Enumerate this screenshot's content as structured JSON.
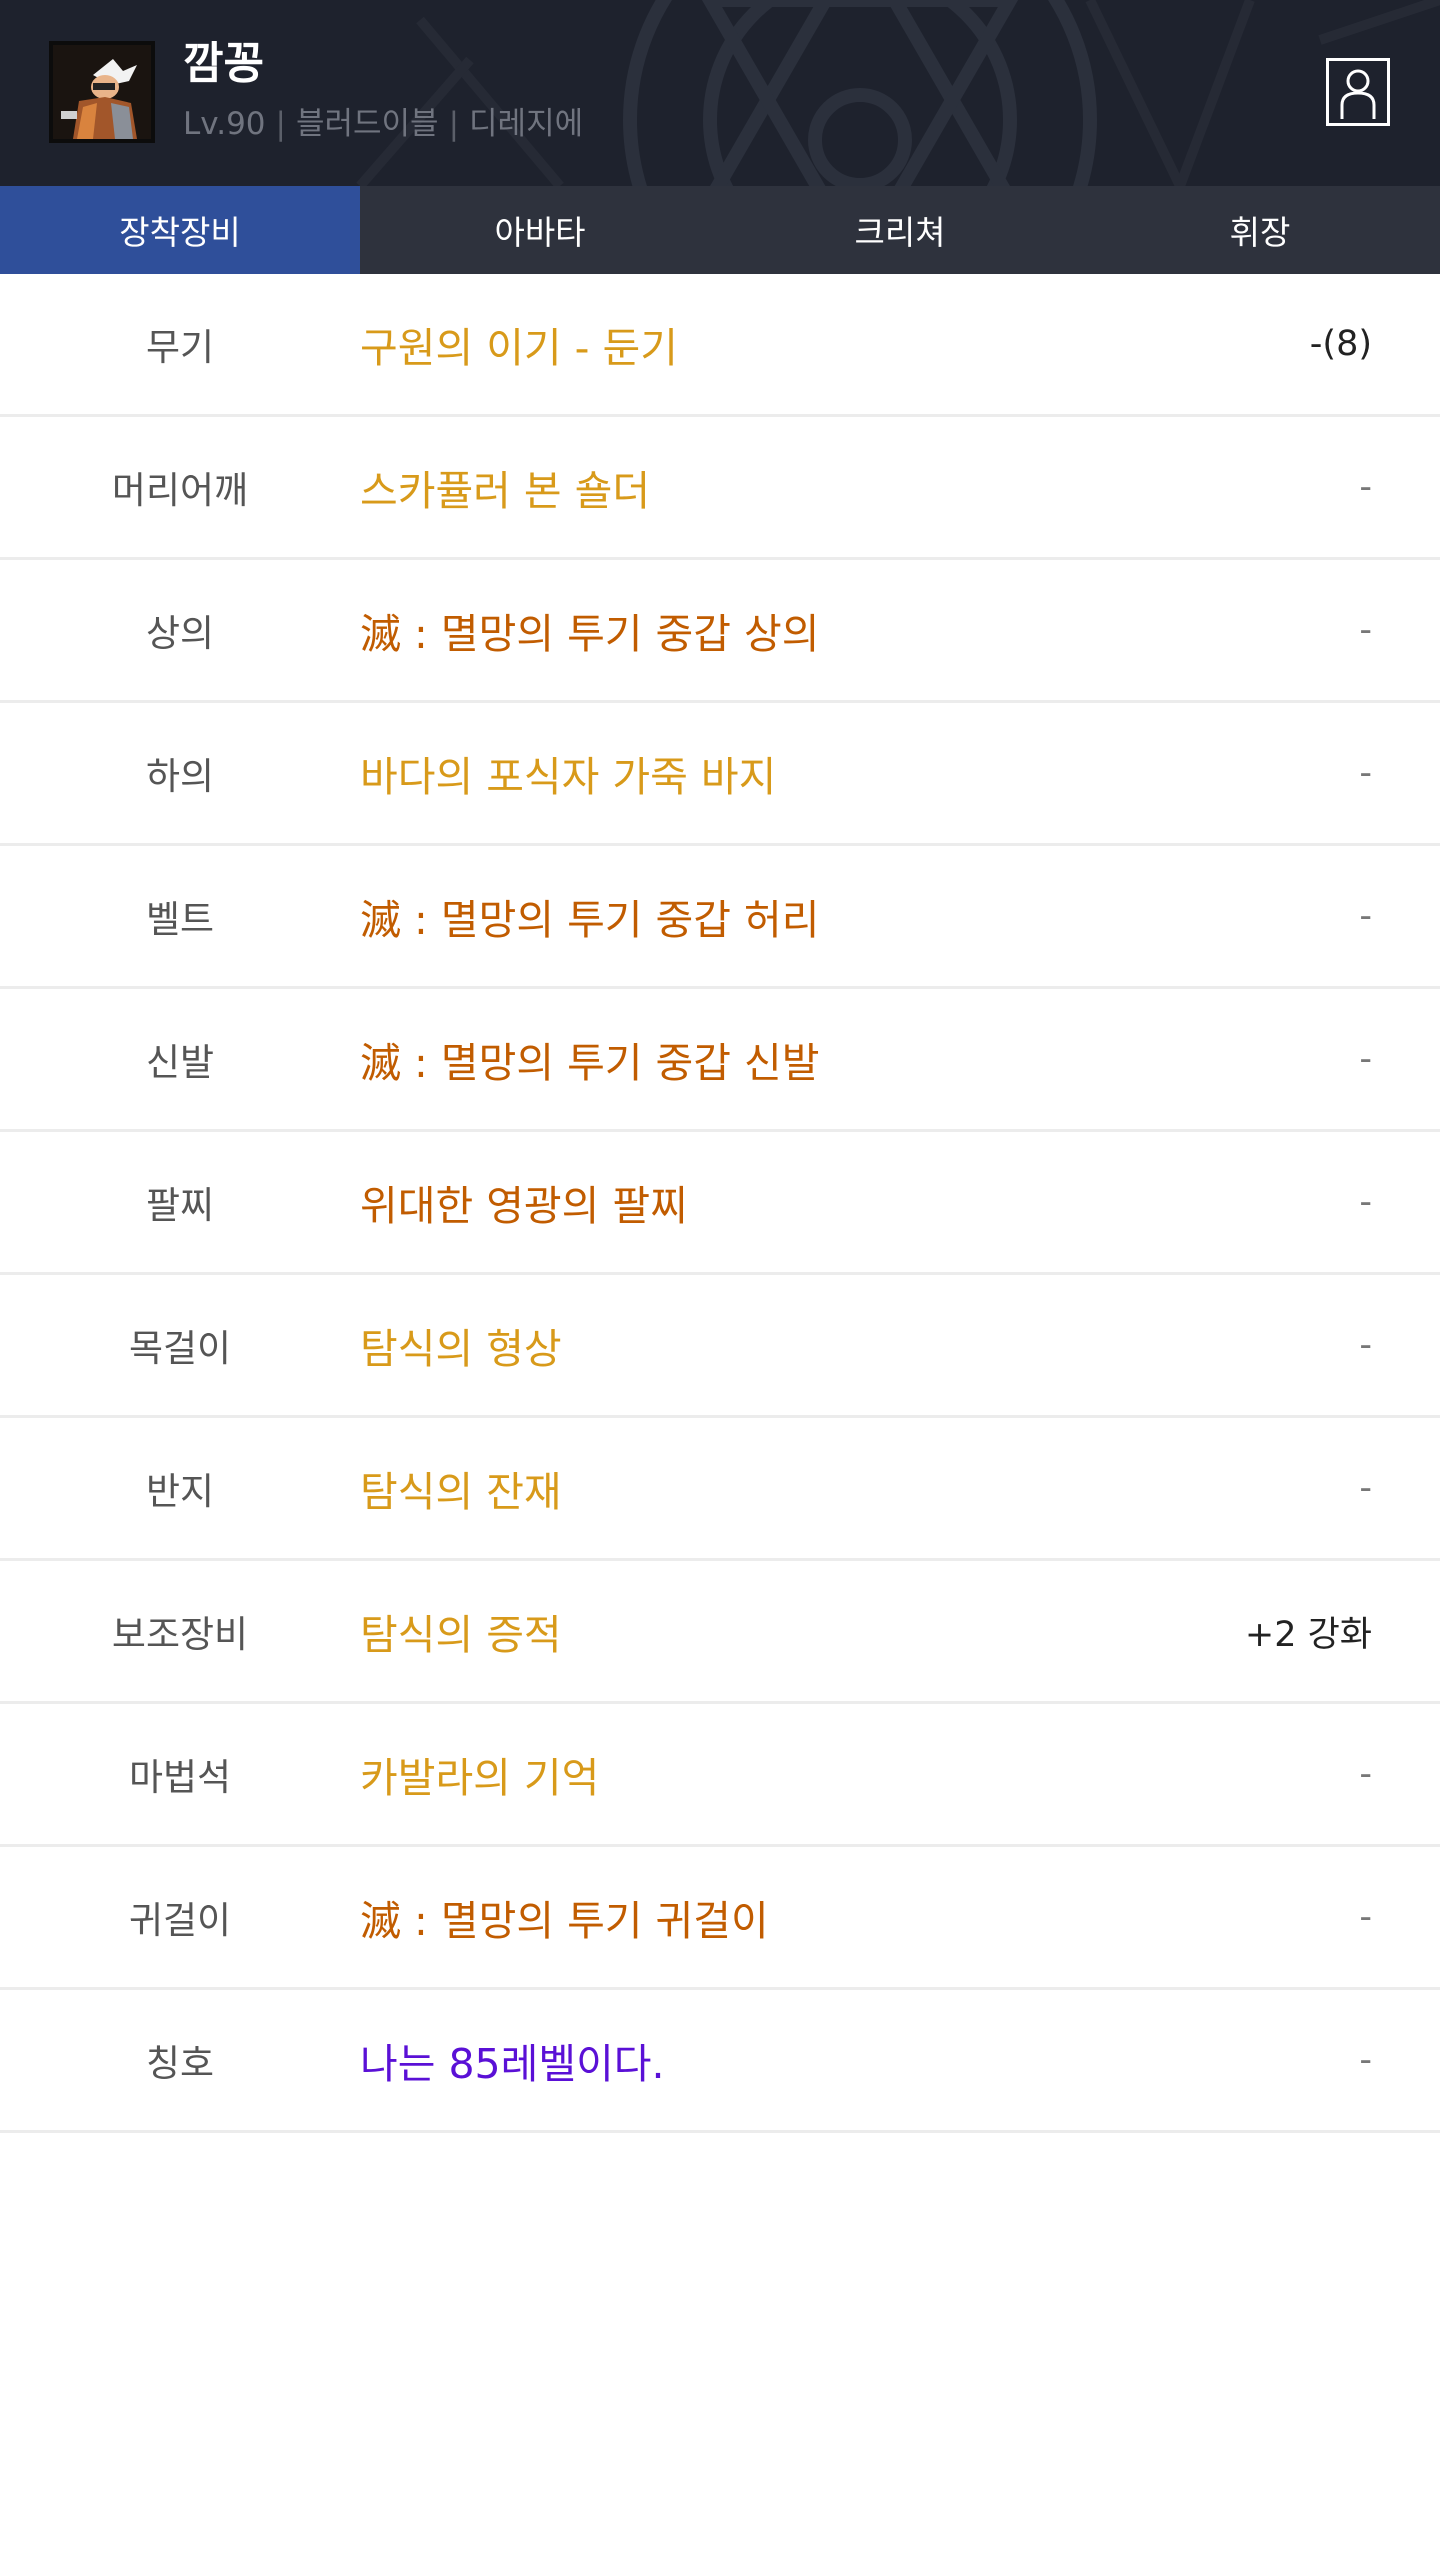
{
  "character": {
    "name": "깜꽁",
    "level": "Lv.90",
    "job": "블러드이블",
    "server": "디레지에",
    "separator": "|"
  },
  "icons": {
    "avatar": "character-portrait",
    "profile": "user-profile-icon"
  },
  "tabs": [
    {
      "label": "장착장비",
      "active": true
    },
    {
      "label": "아바타",
      "active": false
    },
    {
      "label": "크리쳐",
      "active": false
    },
    {
      "label": "휘장",
      "active": false
    }
  ],
  "colors": {
    "header_bg": "#1e222d",
    "tab_bar_bg": "#2e323d",
    "tab_active_bg": "#2f4f9a",
    "unique": "#d89a1a",
    "epic": "#c15c00",
    "rare": "#5a10d6"
  },
  "equipment": [
    {
      "slot": "무기",
      "name": "구원의 이기 - 둔기",
      "color": "#d89a1a",
      "extra": "-(8)"
    },
    {
      "slot": "머리어깨",
      "name": "스카퓰러 본 숄더",
      "color": "#d89a1a",
      "extra": "-"
    },
    {
      "slot": "상의",
      "name": "滅 : 멸망의 투기 중갑 상의",
      "color": "#c15c00",
      "extra": "-"
    },
    {
      "slot": "하의",
      "name": "바다의 포식자 가죽 바지",
      "color": "#d89a1a",
      "extra": "-"
    },
    {
      "slot": "벨트",
      "name": "滅 : 멸망의 투기 중갑 허리",
      "color": "#c15c00",
      "extra": "-"
    },
    {
      "slot": "신발",
      "name": "滅 : 멸망의 투기 중갑 신발",
      "color": "#c15c00",
      "extra": "-"
    },
    {
      "slot": "팔찌",
      "name": "위대한 영광의 팔찌",
      "color": "#c15c00",
      "extra": "-"
    },
    {
      "slot": "목걸이",
      "name": "탐식의 형상",
      "color": "#d89a1a",
      "extra": "-"
    },
    {
      "slot": "반지",
      "name": "탐식의 잔재",
      "color": "#d89a1a",
      "extra": "-"
    },
    {
      "slot": "보조장비",
      "name": "탐식의 증적",
      "color": "#d89a1a",
      "extra": "+2 강화"
    },
    {
      "slot": "마법석",
      "name": "카발라의 기억",
      "color": "#d89a1a",
      "extra": "-"
    },
    {
      "slot": "귀걸이",
      "name": "滅 : 멸망의 투기 귀걸이",
      "color": "#c15c00",
      "extra": "-"
    },
    {
      "slot": "칭호",
      "name": "나는 85레벨이다.",
      "color": "#5a10d6",
      "extra": "-"
    }
  ]
}
